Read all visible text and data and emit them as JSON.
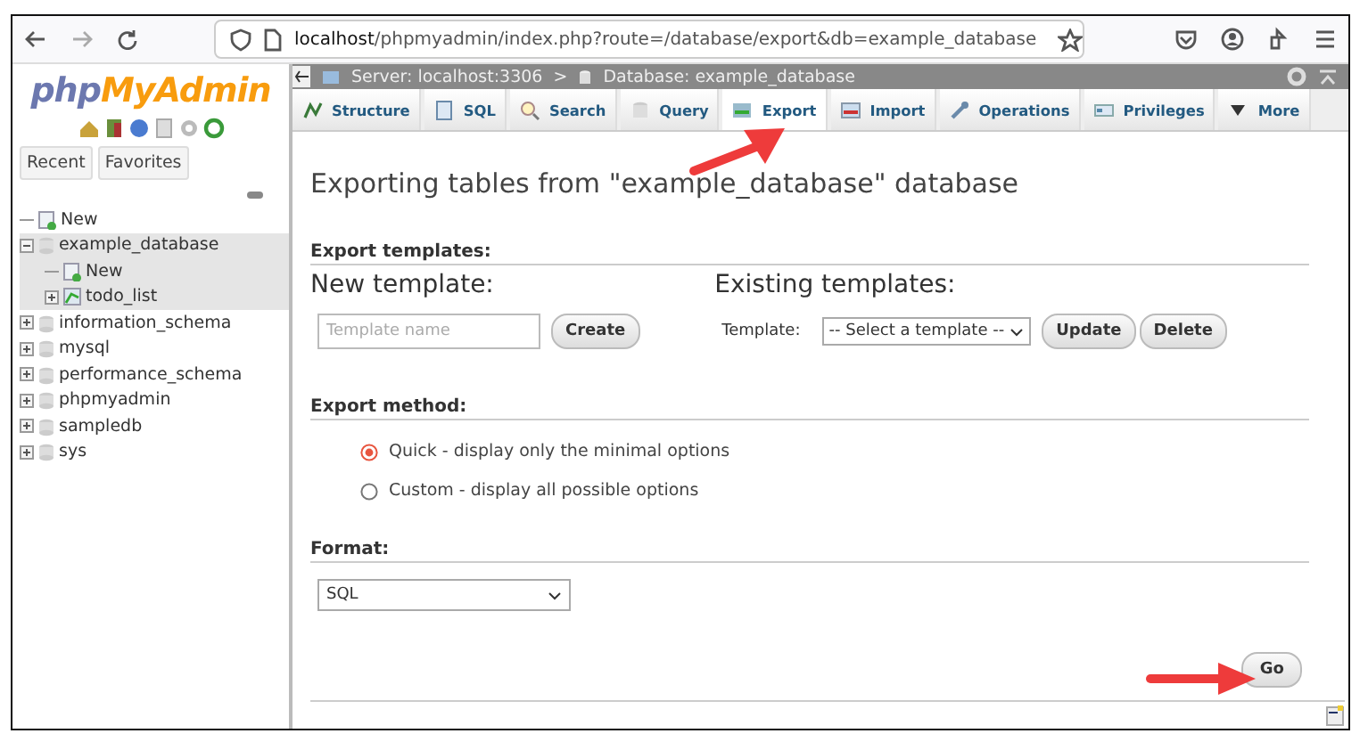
{
  "browser": {
    "url_host": "localhost",
    "url_path": "/phpmyadmin/index.php?route=/database/export&db=example_database"
  },
  "sidebar": {
    "logo_part1": "php",
    "logo_part2": "MyAdmin",
    "tabs": [
      {
        "label": "Recent"
      },
      {
        "label": "Favorites"
      }
    ],
    "tree": [
      {
        "label": "New",
        "kind": "new"
      },
      {
        "label": "example_database",
        "kind": "db",
        "expanded": true,
        "selected": true,
        "children": [
          {
            "label": "New",
            "kind": "new"
          },
          {
            "label": "todo_list",
            "kind": "table",
            "expanded": false,
            "selected": false
          }
        ]
      },
      {
        "label": "information_schema",
        "kind": "db",
        "expanded": false,
        "selected": false
      },
      {
        "label": "mysql",
        "kind": "db",
        "expanded": false,
        "selected": false
      },
      {
        "label": "performance_schema",
        "kind": "db",
        "expanded": false,
        "selected": false
      },
      {
        "label": "phpmyadmin",
        "kind": "db",
        "expanded": false,
        "selected": false
      },
      {
        "label": "sampledb",
        "kind": "db",
        "expanded": false,
        "selected": false
      },
      {
        "label": "sys",
        "kind": "db",
        "expanded": false,
        "selected": false
      }
    ]
  },
  "breadcrumb": {
    "items": [
      {
        "label": "Server: localhost:3306",
        "kind": "server"
      },
      {
        "label": "Database: example_database",
        "kind": "db"
      }
    ],
    "separator": ">"
  },
  "tabs": [
    {
      "label": "Structure",
      "kind": "structure",
      "selected": false
    },
    {
      "label": "SQL",
      "kind": "sql",
      "selected": false
    },
    {
      "label": "Search",
      "kind": "search",
      "selected": false
    },
    {
      "label": "Query",
      "kind": "query",
      "selected": false
    },
    {
      "label": "Export",
      "kind": "export",
      "selected": true
    },
    {
      "label": "Import",
      "kind": "import",
      "selected": false
    },
    {
      "label": "Operations",
      "kind": "operations",
      "selected": false
    },
    {
      "label": "Privileges",
      "kind": "privileges",
      "selected": false
    },
    {
      "label": "More",
      "kind": "more",
      "selected": false
    }
  ],
  "heading": "Exporting tables from \"example_database\" database",
  "templates": {
    "title": "Export templates:",
    "new_title": "New template:",
    "name_placeholder": "Template name",
    "create": "Create",
    "existing_title": "Existing templates:",
    "template_label": "Template:",
    "template_select": "-- Select a template --",
    "update": "Update",
    "delete": "Delete"
  },
  "method": {
    "title": "Export method:",
    "options": [
      {
        "label": "Quick - display only the minimal options",
        "selected": true
      },
      {
        "label": "Custom - display all possible options",
        "selected": false
      }
    ]
  },
  "format": {
    "title": "Format:",
    "value": "SQL"
  },
  "go": "Go"
}
